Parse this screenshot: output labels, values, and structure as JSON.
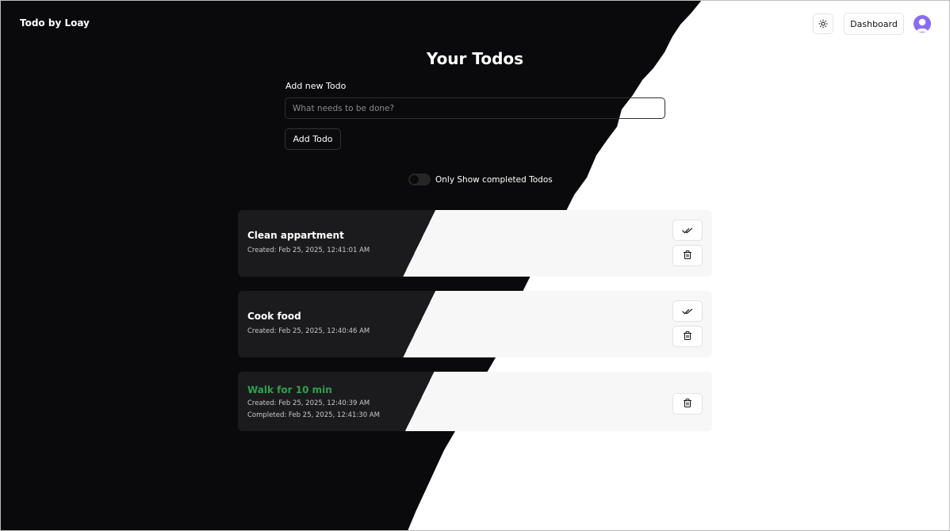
{
  "header": {
    "brand": "Todo by Loay",
    "theme_toggle_icon": "sun-icon",
    "dashboard_label": "Dashboard",
    "avatar_icon": "user-avatar-icon"
  },
  "main": {
    "title": "Your Todos",
    "add_label": "Add new Todo",
    "input_placeholder": "What needs to be done?",
    "input_value": "",
    "add_button": "Add Todo",
    "filter_label": "Only Show completed Todos",
    "filter_on": false
  },
  "todos": [
    {
      "title": "Clean appartment",
      "created": "Created: Feb 25, 2025, 12:41:01 AM",
      "completed": null
    },
    {
      "title": "Cook food",
      "created": "Created: Feb 25, 2025, 12:40:46 AM",
      "completed": null
    },
    {
      "title": "Walk for 10 min",
      "created": "Created: Feb 25, 2025, 12:40:39 AM",
      "completed": "Completed: Feb 25, 2025, 12:41:30 AM"
    }
  ],
  "colors": {
    "dark_bg": "#0a0a0c",
    "light_bg": "#ffffff",
    "card_dark": "#1b1b1e",
    "card_light": "#f7f7f7",
    "completed_text": "#2ea04b",
    "avatar": "#8a6cf2"
  }
}
